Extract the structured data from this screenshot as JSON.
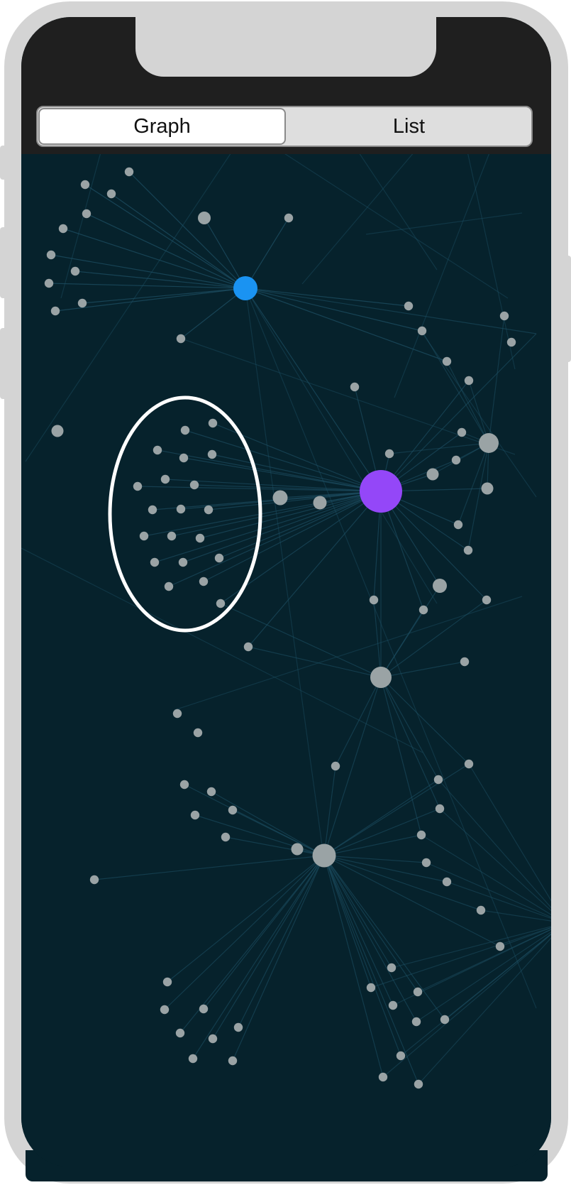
{
  "tabs": {
    "graph_label": "Graph",
    "list_label": "List",
    "selected": "Graph"
  },
  "graph": {
    "background_color": "#06222c",
    "edge_color": "#1d4f63",
    "node_color": "#9aa3a5",
    "hub_colors": {
      "blue": "#1a93f2",
      "purple": "#9447f8"
    },
    "selection_outline_color": "#ffffff"
  }
}
